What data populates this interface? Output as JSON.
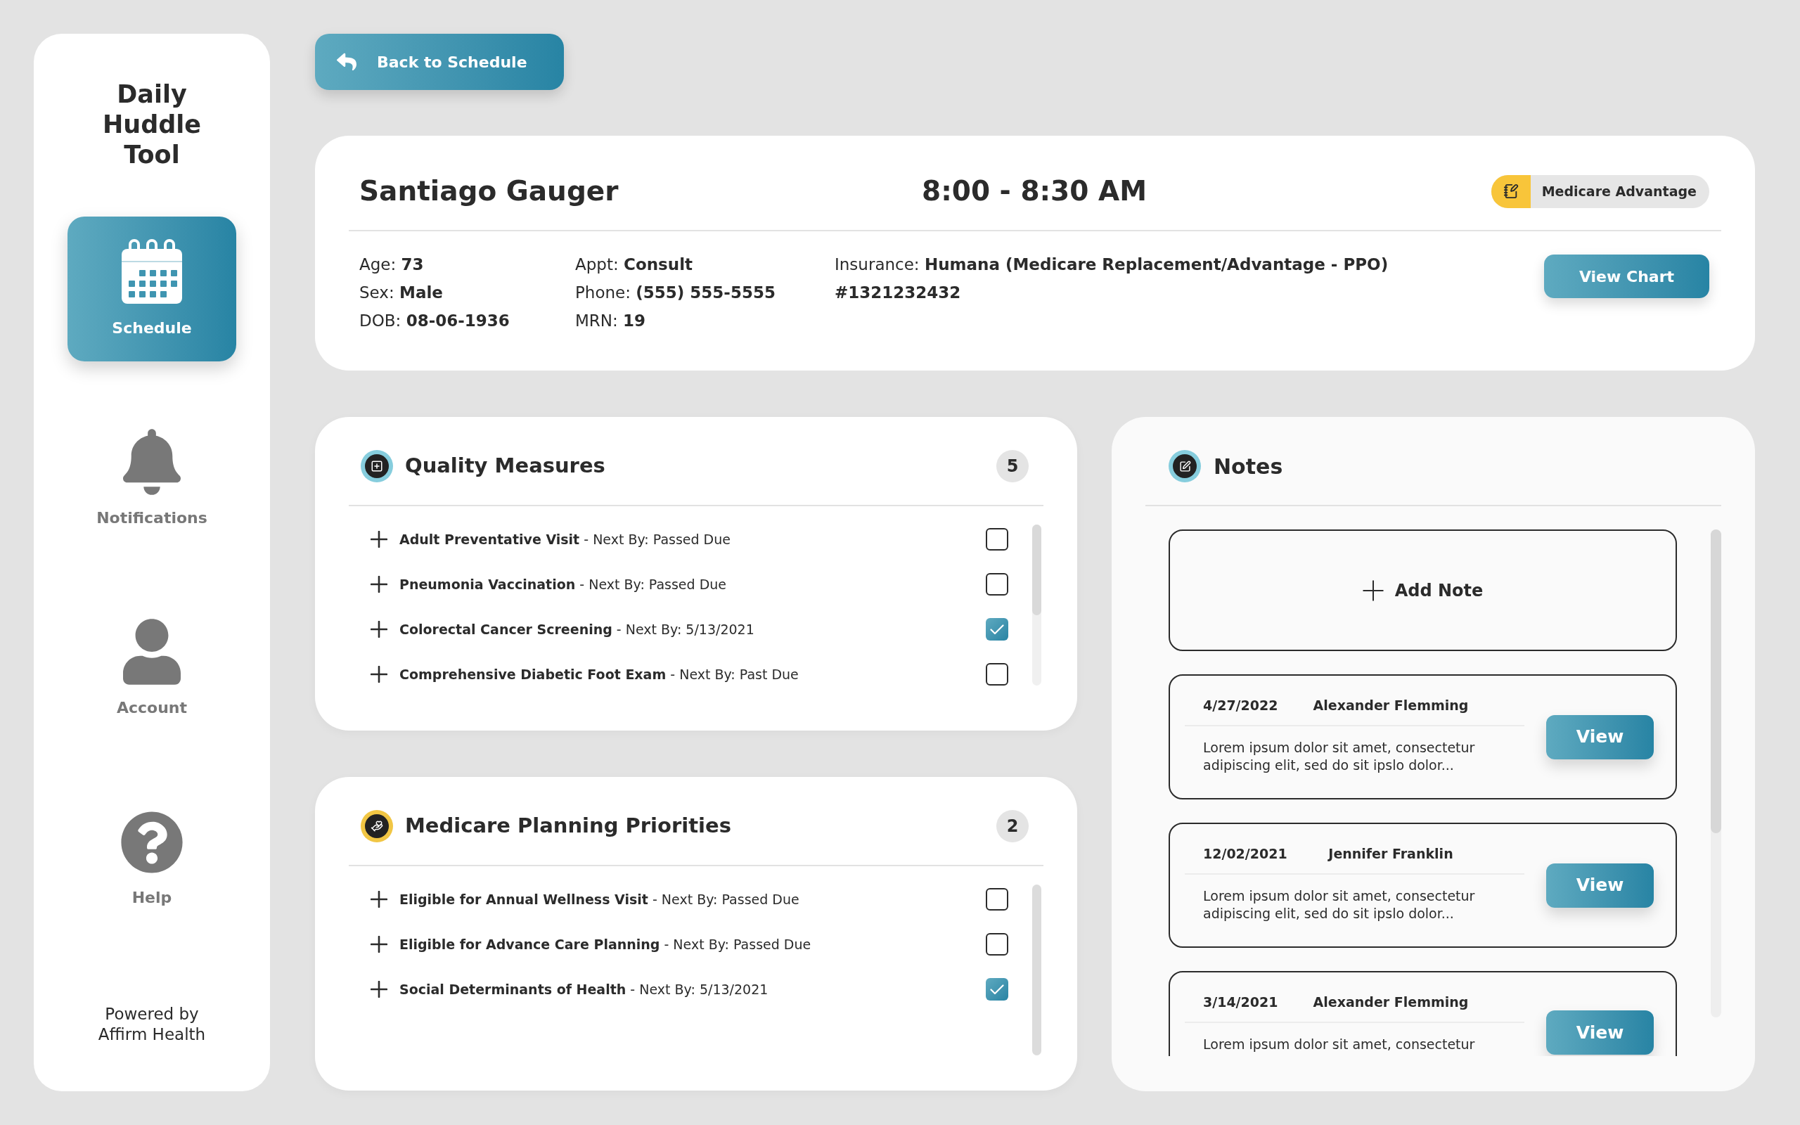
{
  "back_button": {
    "label": "Back to Schedule"
  },
  "sidebar": {
    "title": "Daily Huddle Tool",
    "items": [
      {
        "label": "Schedule",
        "selected": true
      },
      {
        "label": "Notifications",
        "selected": false
      },
      {
        "label": "Account",
        "selected": false
      },
      {
        "label": "Help",
        "selected": false
      }
    ],
    "footer": "Powered by Affirm Health"
  },
  "patient": {
    "name": "Santiago Gauger",
    "time": "8:00 - 8:30 AM",
    "plan_badge": "Medicare Advantage",
    "field_columns": [
      [
        {
          "label": "Age:",
          "value": "73"
        },
        {
          "label": "Sex:",
          "value": "Male"
        },
        {
          "label": "DOB:",
          "value": "08-06-1936"
        }
      ],
      [
        {
          "label": "Appt:",
          "value": "Consult"
        },
        {
          "label": "Phone:",
          "value": "(555) 555-5555"
        },
        {
          "label": "MRN:",
          "value": "19"
        }
      ],
      [
        {
          "label": "Insurance:",
          "value": "Humana (Medicare Replacement/Advantage - PPO) #1321232432"
        }
      ]
    ],
    "view_chart_button": "View Chart"
  },
  "checklists": [
    {
      "kind": "quality",
      "title": "Quality Measures",
      "count": "5",
      "items": [
        {
          "text": "**Adult Preventative Visit** - Next By: Passed Due",
          "checked": false
        },
        {
          "text": "**Pneumonia Vaccination** - Next By: Passed Due",
          "checked": false
        },
        {
          "text": "**Colorectal Cancer Screening** - Next By: 5/13/2021",
          "checked": true
        },
        {
          "text": "**Comprehensive Diabetic Foot Exam** - Next By: Past Due",
          "checked": false
        }
      ]
    },
    {
      "kind": "medicare",
      "title": "Medicare Planning Priorities",
      "count": "2",
      "items": [
        {
          "text": "**Eligible for Annual Wellness Visit** - Next By: Passed Due",
          "checked": false
        },
        {
          "text": "**Eligible for Advance Care Planning** - Next By: Passed Due",
          "checked": false
        },
        {
          "text": "**Social Determinants of Health** - Next By: 5/13/2021",
          "checked": true
        }
      ]
    }
  ],
  "notes": {
    "title": "Notes",
    "add_button": "Add Note",
    "entries": [
      {
        "date": "4/27/2022",
        "author": "Alexander Flemming",
        "text": "Lorem ipsum dolor sit amet, consectetur adipiscing elit, sed do sit ipslo dolor...",
        "button": "View"
      },
      {
        "date": "12/02/2021",
        "author": "Jennifer Franklin",
        "text": "Lorem ipsum dolor sit amet, consectetur adipiscing elit, sed do sit ipslo dolor...",
        "button": "View"
      },
      {
        "date": "3/14/2021",
        "author": "Alexander Flemming",
        "text": "Lorem ipsum dolor sit amet, consectetur",
        "button": "View"
      }
    ]
  }
}
